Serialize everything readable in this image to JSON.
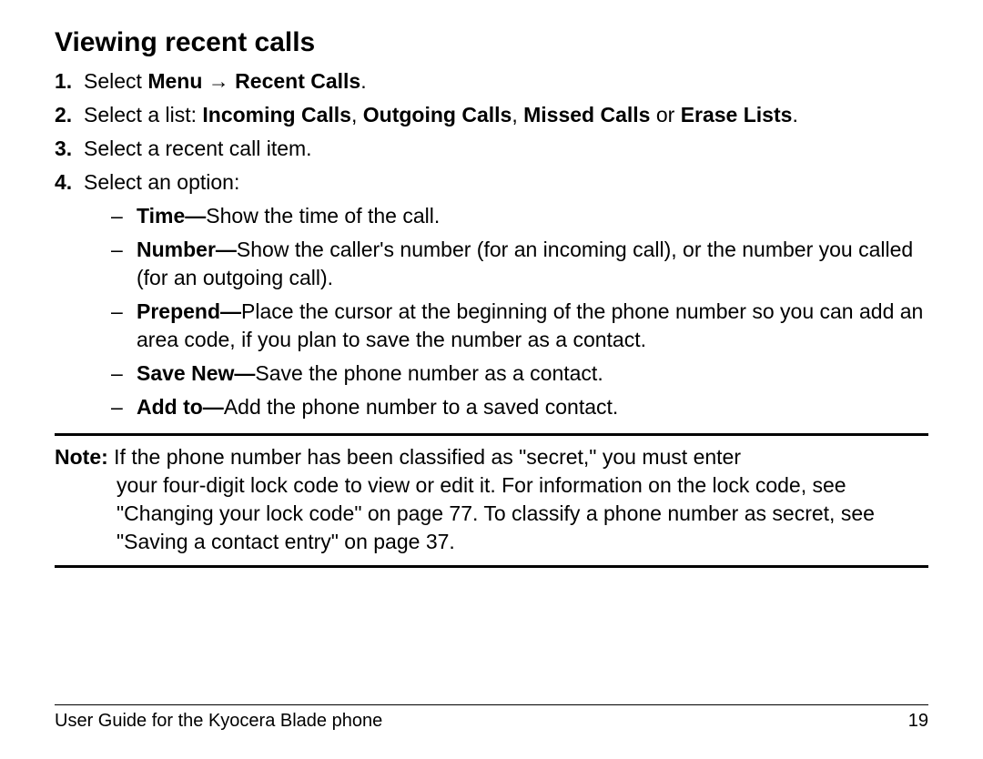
{
  "heading": "Viewing recent calls",
  "steps": {
    "s1_num": "1.",
    "s1_pre": "Select ",
    "s1_bold1": "Menu",
    "s1_arrow": " → ",
    "s1_bold2": "Recent Calls",
    "s1_post": ".",
    "s2_num": "2.",
    "s2_pre": "Select a list: ",
    "s2_b1": "Incoming Calls",
    "s2_c1": ", ",
    "s2_b2": "Outgoing Calls",
    "s2_c2": ", ",
    "s2_b3": "Missed Calls",
    "s2_or": " or ",
    "s2_b4": "Erase Lists",
    "s2_post": ".",
    "s3_num": "3.",
    "s3_text": "Select a recent call item.",
    "s4_num": "4.",
    "s4_text": "Select an option:"
  },
  "opts": {
    "o1_b": "Time—",
    "o1_t": "Show the time of the call.",
    "o2_b": "Number—",
    "o2_t": "Show the caller's number (for an incoming call), or the number you called (for an outgoing call).",
    "o3_b": "Prepend—",
    "o3_t": "Place the cursor at the beginning of the phone number so you can add an area code, if you plan to save the number as a contact.",
    "o4_b": "Save New—",
    "o4_t": "Save the phone number as a contact.",
    "o5_b": "Add to—",
    "o5_t": "Add the phone number to a saved contact."
  },
  "note": {
    "label": "Note:",
    "first_line": " If the phone number has been classified as \"secret,\" you must enter",
    "rest": "your four-digit lock code to view or edit it. For information on the lock code, see \"Changing your lock code\" on page 77. To classify a phone number as secret, see \"Saving a contact entry\" on page 37."
  },
  "footer": {
    "left": "User Guide for the Kyocera Blade phone",
    "right": "19"
  }
}
